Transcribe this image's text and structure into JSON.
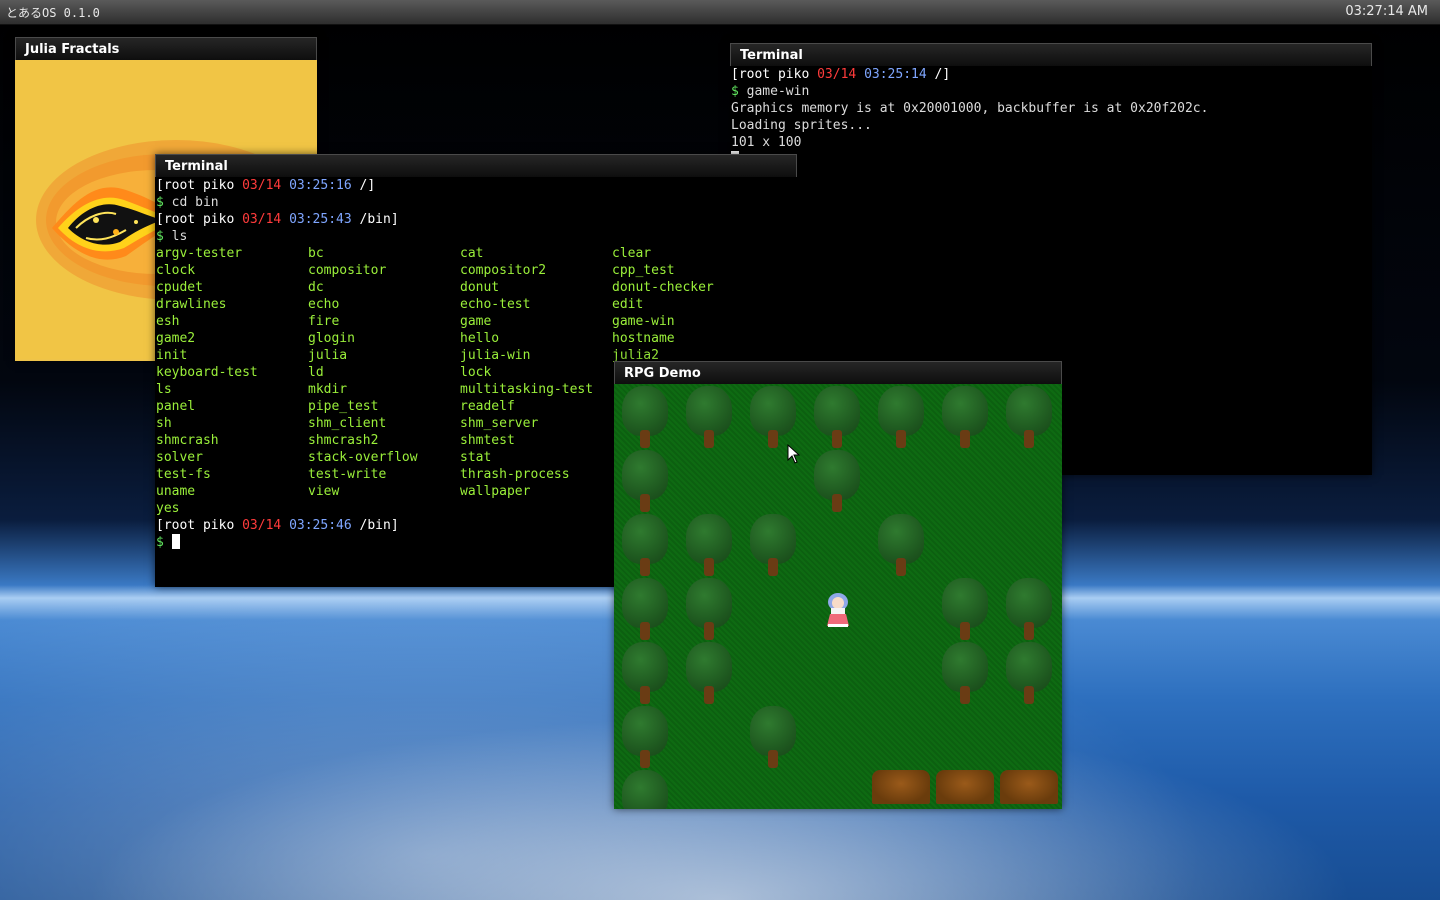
{
  "panel": {
    "title": "とあるOS 0.1.0",
    "clock": "03:27:14 AM"
  },
  "julia_window": {
    "title": "Julia Fractals"
  },
  "terminal_back": {
    "title": "Terminal",
    "prompt": {
      "user": "root",
      "host": "piko",
      "date": "03/14",
      "time": "03:25:14",
      "cwd": "/"
    },
    "command": "game-win",
    "output": [
      "Graphics memory is at 0x20001000, backbuffer is at 0x20f202c.",
      "Loading sprites...",
      "101 x 100"
    ]
  },
  "terminal_front": {
    "title": "Terminal",
    "prompts": [
      {
        "user": "root",
        "host": "piko",
        "date": "03/14",
        "time": "03:25:16",
        "cwd": "/",
        "command": "cd bin"
      },
      {
        "user": "root",
        "host": "piko",
        "date": "03/14",
        "time": "03:25:43",
        "cwd": "/bin",
        "command": "ls"
      },
      {
        "user": "root",
        "host": "piko",
        "date": "03/14",
        "time": "03:25:46",
        "cwd": "/bin",
        "command": ""
      }
    ],
    "ls_files": [
      "argv-tester",
      "bc",
      "cat",
      "clear",
      "clock",
      "compositor",
      "compositor2",
      "cpp_test",
      "cpudet",
      "dc",
      "donut",
      "donut-checker",
      "drawlines",
      "echo",
      "echo-test",
      "edit",
      "esh",
      "fire",
      "game",
      "game-win",
      "game2",
      "glogin",
      "hello",
      "hostname",
      "init",
      "julia",
      "julia-win",
      "julia2",
      "keyboard-test",
      "ld",
      "lock",
      "",
      "ls",
      "mkdir",
      "multitasking-test",
      "",
      "panel",
      "pipe_test",
      "readelf",
      "",
      "sh",
      "shm_client",
      "shm_server",
      "",
      "shmcrash",
      "shmcrash2",
      "shmtest",
      "",
      "solver",
      "stack-overflow",
      "stat",
      "",
      "test-fs",
      "test-write",
      "thrash-process",
      "",
      "uname",
      "view",
      "wallpaper",
      "",
      "yes"
    ]
  },
  "rpg_window": {
    "title": "RPG Demo"
  },
  "colors": {
    "prompt_date": "#ff3b3b",
    "prompt_time": "#7fa6ff",
    "executable": "#9aef3a",
    "grass": "#0e6b12"
  }
}
